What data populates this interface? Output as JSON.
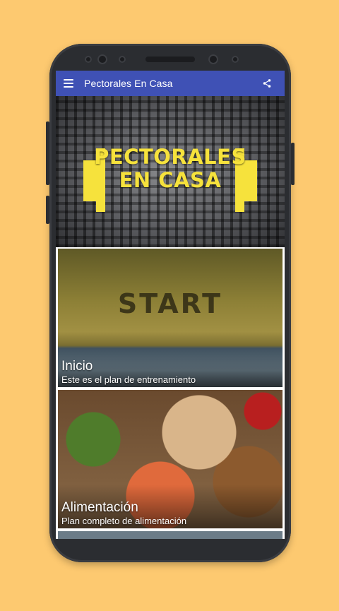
{
  "app": {
    "title": "Pectorales En Casa",
    "bar_color": "#3F51B5",
    "background_color": "#FDC970"
  },
  "icons": {
    "menu": "menu-icon",
    "share": "share-icon"
  },
  "banner": {
    "line1": "PECTORALES",
    "line2": "EN CASA",
    "accent_color": "#F6E23C"
  },
  "cards": [
    {
      "image_text": "START",
      "title": "Inicio",
      "subtitle": "Este es el plan de entrenamiento"
    },
    {
      "title": "Alimentación",
      "subtitle": "Plan completo de alimentación"
    }
  ]
}
